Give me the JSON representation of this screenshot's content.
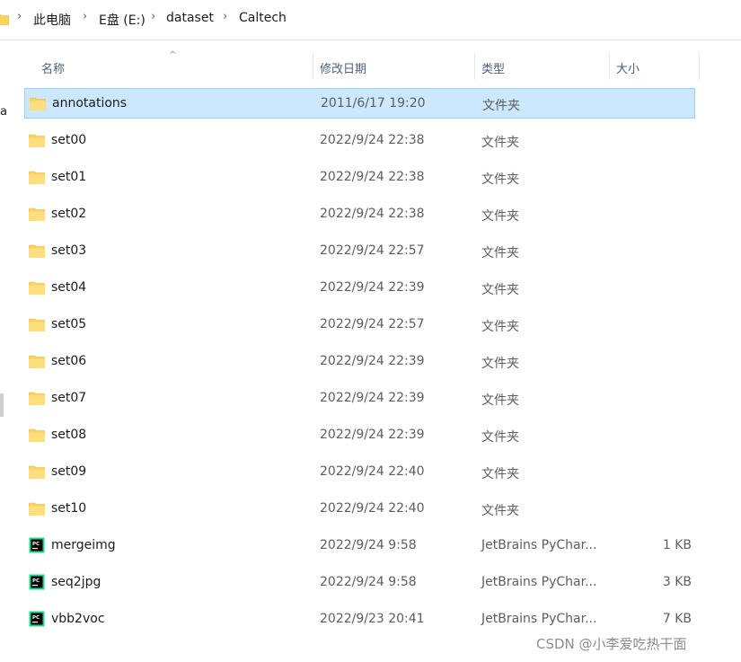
{
  "breadcrumb": {
    "segments": [
      "此电脑",
      "E盘 (E:)",
      "dataset",
      "Caltech"
    ],
    "separator": "›"
  },
  "nav_remnant": {
    "text": "a"
  },
  "columns": {
    "name": "名称",
    "date": "修改日期",
    "type": "类型",
    "size": "大小",
    "sort_indicator": "^"
  },
  "files": [
    {
      "name": "annotations",
      "date": "2011/6/17 19:20",
      "type": "文件夹",
      "size": "",
      "icon": "folder-icon",
      "selected": true
    },
    {
      "name": "set00",
      "date": "2022/9/24 22:38",
      "type": "文件夹",
      "size": "",
      "icon": "folder-icon"
    },
    {
      "name": "set01",
      "date": "2022/9/24 22:38",
      "type": "文件夹",
      "size": "",
      "icon": "folder-icon"
    },
    {
      "name": "set02",
      "date": "2022/9/24 22:38",
      "type": "文件夹",
      "size": "",
      "icon": "folder-icon"
    },
    {
      "name": "set03",
      "date": "2022/9/24 22:57",
      "type": "文件夹",
      "size": "",
      "icon": "folder-icon"
    },
    {
      "name": "set04",
      "date": "2022/9/24 22:39",
      "type": "文件夹",
      "size": "",
      "icon": "folder-icon"
    },
    {
      "name": "set05",
      "date": "2022/9/24 22:57",
      "type": "文件夹",
      "size": "",
      "icon": "folder-icon"
    },
    {
      "name": "set06",
      "date": "2022/9/24 22:39",
      "type": "文件夹",
      "size": "",
      "icon": "folder-icon"
    },
    {
      "name": "set07",
      "date": "2022/9/24 22:39",
      "type": "文件夹",
      "size": "",
      "icon": "folder-icon"
    },
    {
      "name": "set08",
      "date": "2022/9/24 22:39",
      "type": "文件夹",
      "size": "",
      "icon": "folder-icon"
    },
    {
      "name": "set09",
      "date": "2022/9/24 22:40",
      "type": "文件夹",
      "size": "",
      "icon": "folder-icon"
    },
    {
      "name": "set10",
      "date": "2022/9/24 22:40",
      "type": "文件夹",
      "size": "",
      "icon": "folder-icon"
    },
    {
      "name": "mergeimg",
      "date": "2022/9/24 9:58",
      "type": "JetBrains PyChar...",
      "size": "1 KB",
      "icon": "pycharm-file-icon"
    },
    {
      "name": "seq2jpg",
      "date": "2022/9/24 9:58",
      "type": "JetBrains PyChar...",
      "size": "3 KB",
      "icon": "pycharm-file-icon"
    },
    {
      "name": "vbb2voc",
      "date": "2022/9/23 20:41",
      "type": "JetBrains PyChar...",
      "size": "7 KB",
      "icon": "pycharm-file-icon"
    }
  ],
  "watermark": "CSDN @小李爱吃热干面",
  "colors": {
    "selection_bg": "#cce8ff",
    "selection_border": "#99d1ff",
    "folder_yellow": "#ffd25e",
    "pycharm_green": "#21d789",
    "header_text": "#4c607a"
  }
}
